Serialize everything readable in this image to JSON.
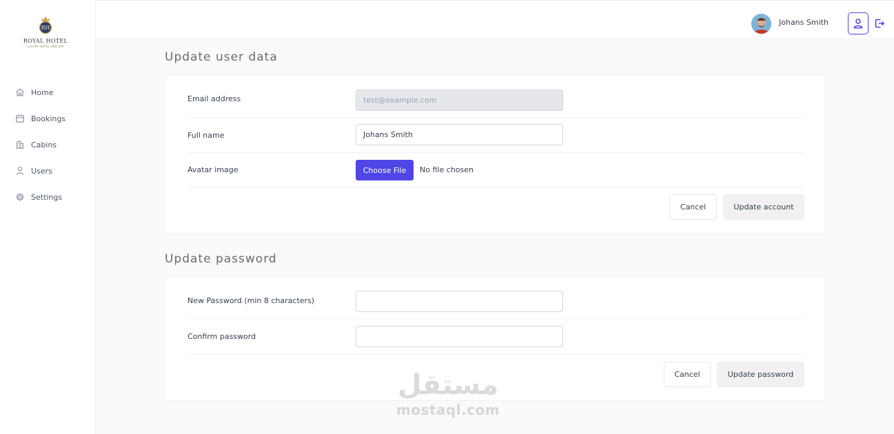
{
  "app": {
    "logo": {
      "brand": "ROYAL HOTEL",
      "monogram": "RH",
      "tagline": "LUXURY HOTEL AND SPA"
    }
  },
  "sidebar": {
    "items": [
      {
        "label": "Home",
        "icon": "home-icon"
      },
      {
        "label": "Bookings",
        "icon": "calendar-icon"
      },
      {
        "label": "Cabins",
        "icon": "building-icon"
      },
      {
        "label": "Users",
        "icon": "user-icon"
      },
      {
        "label": "Settings",
        "icon": "gear-icon"
      }
    ]
  },
  "header": {
    "user_name": "Johans Smith",
    "account_icon": "user-icon",
    "logout_icon": "logout-icon"
  },
  "user_section": {
    "title": "Update user data",
    "email_label": "Email address",
    "email_value": "test@example.com",
    "name_label": "Full name",
    "name_value": "Johans Smith",
    "avatar_label": "Avatar image",
    "file_button": "Choose File",
    "file_status": "No file chosen",
    "cancel": "Cancel",
    "submit": "Update account"
  },
  "password_section": {
    "title": "Update password",
    "new_label": "New Password (min 8 characters)",
    "new_value": "",
    "confirm_label": "Confirm password",
    "confirm_value": "",
    "cancel": "Cancel",
    "submit": "Update password"
  },
  "watermark": {
    "arabic": "مستقل",
    "latin": "mostaql.com"
  },
  "colors": {
    "accent": "#4f46e5",
    "background": "#f9fafb",
    "card": "#ffffff"
  }
}
